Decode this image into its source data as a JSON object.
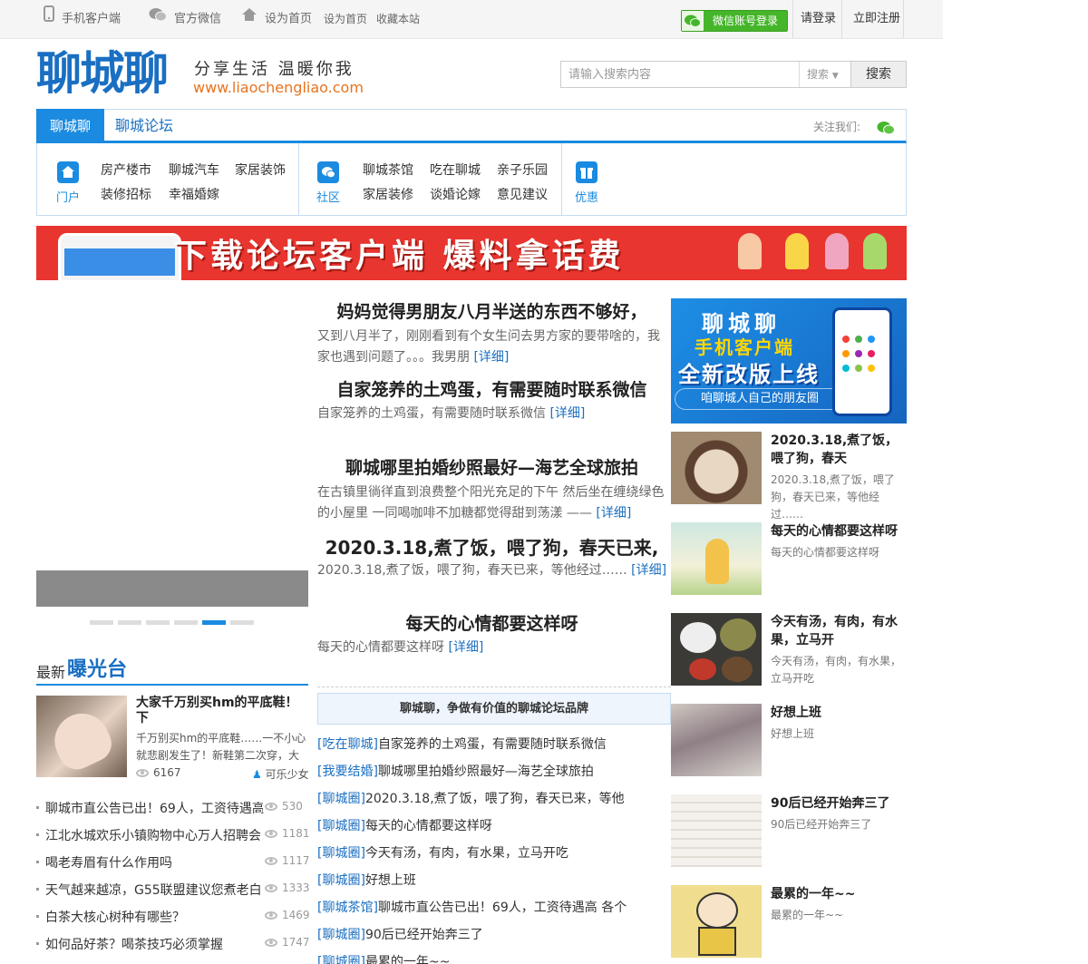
{
  "topbar": {
    "mobile_client": "手机客户端",
    "wechat": "官方微信",
    "set_home": "设为首页",
    "set_home2": "设为首页",
    "bookmark": "收藏本站",
    "wechat_login": "微信账号登录",
    "login": "请登录",
    "register": "立即注册"
  },
  "header": {
    "logo": "聊城聊",
    "slogan": "分享生活 温暖你我",
    "url": "www.liaochengliao.com",
    "search_placeholder": "请输入搜索内容",
    "search_type": "搜索",
    "search_button": "搜索"
  },
  "nav": {
    "active_tab": "聊城聊",
    "tab": "聊城论坛",
    "follow": "关注我们:"
  },
  "subnav": {
    "groups": [
      {
        "label": "门户",
        "links": [
          "房产楼市",
          "聊城汽车",
          "家居装饰",
          "装修招标",
          "幸福婚嫁"
        ]
      },
      {
        "label": "社区",
        "links": [
          "聊城茶馆",
          "吃在聊城",
          "亲子乐园",
          "家居装修",
          "谈婚论嫁",
          "意见建议"
        ]
      },
      {
        "label": "优惠",
        "links": []
      }
    ]
  },
  "banner": {
    "text": "下载论坛客户端  爆料拿话费"
  },
  "slider": {
    "dots": 6,
    "active_dot": 5
  },
  "exposure": {
    "title_small": "最新",
    "title_big": "曝光台",
    "featured": {
      "title": "大家千万别买hm的平底鞋！下",
      "desc": "千万别买hm的平底鞋……一不小心就悲剧发生了！新鞋第二次穿，大",
      "views": "6167",
      "author": "可乐少女"
    },
    "list": [
      {
        "title": "聊城市直公告已出！69人，工资待遇高",
        "views": "530"
      },
      {
        "title": "江北水城欢乐小镇购物中心万人招聘会",
        "views": "1181"
      },
      {
        "title": "喝老寿眉有什么作用吗",
        "views": "1117"
      },
      {
        "title": "天气越来越凉，G55联盟建议您煮老白",
        "views": "1333"
      },
      {
        "title": "白茶大核心树种有哪些？",
        "views": "1469"
      },
      {
        "title": "如何品好茶？喝茶技巧必须掌握",
        "views": "1747"
      }
    ]
  },
  "articles": [
    {
      "title": "妈妈觉得男朋友八月半送的东西不够好，",
      "desc": "又到八月半了，刚刚看到有个女生问去男方家的要带啥的，我家也遇到问题了。。。我男朋",
      "more": "[详细]"
    },
    {
      "title": "自家笼养的土鸡蛋，有需要随时联系微信",
      "desc": "自家笼养的土鸡蛋，有需要随时联系微信",
      "more": "[详细]"
    },
    {
      "title": "聊城哪里拍婚纱照最好—海艺全球旅拍",
      "desc": "在古镇里徜徉直到浪费整个阳光充足的下午 然后坐在缠绕绿色的小屋里 一同喝咖啡不加糖都觉得甜到荡漾 ——",
      "more": "[详细]"
    },
    {
      "title": "2020.3.18,煮了饭，喂了狗，春天已来,",
      "desc": "2020.3.18,煮了饭，喂了狗，春天已来，等他经过……",
      "more": "[详细]"
    },
    {
      "title": "每天的心情都要这样呀",
      "desc": "每天的心情都要这样呀",
      "more": "[详细]"
    }
  ],
  "brand_bar": "聊城聊，争做有价值的聊城论坛品牌",
  "thread_list": [
    {
      "cat": "[吃在聊城]",
      "title": "自家笼养的土鸡蛋，有需要随时联系微信"
    },
    {
      "cat": "[我要结婚]",
      "title": "聊城哪里拍婚纱照最好—海艺全球旅拍"
    },
    {
      "cat": "[聊城圈]",
      "title": "2020.3.18,煮了饭，喂了狗，春天已来，等他"
    },
    {
      "cat": "[聊城圈]",
      "title": "每天的心情都要这样呀"
    },
    {
      "cat": "[聊城圈]",
      "title": "今天有汤，有肉，有水果，立马开吃"
    },
    {
      "cat": "[聊城圈]",
      "title": "好想上班"
    },
    {
      "cat": "[聊城茶馆]",
      "title": "聊城市直公告已出！69人，工资待遇高 各个"
    },
    {
      "cat": "[聊城圈]",
      "title": "90后已经开始奔三了"
    },
    {
      "cat": "[聊城圈]",
      "title": "最累的一年~~"
    }
  ],
  "app_ad": {
    "line1": "聊城聊",
    "line2": "手机客户端",
    "line3": "全新改版上线",
    "line4": "咱聊城人自己的朋友圈"
  },
  "side_posts": [
    {
      "title": "2020.3.18,煮了饭，喂了狗，春天",
      "desc": "2020.3.18,煮了饭，喂了狗，春天已来，等他经过……"
    },
    {
      "title": "每天的心情都要这样呀",
      "desc": "每天的心情都要这样呀"
    },
    {
      "title": "今天有汤，有肉，有水果，立马开",
      "desc": "今天有汤，有肉，有水果，立马开吃"
    },
    {
      "title": "好想上班",
      "desc": "好想上班"
    },
    {
      "title": "90后已经开始奔三了",
      "desc": "90后已经开始奔三了"
    },
    {
      "title": "最累的一年~~",
      "desc": "最累的一年~~"
    }
  ],
  "colors": {
    "primary": "#1a8be0",
    "link": "#1a6fc2",
    "wechat_green": "#45b52a",
    "banner_red": "#e8352f",
    "url_orange": "#e8731e"
  }
}
